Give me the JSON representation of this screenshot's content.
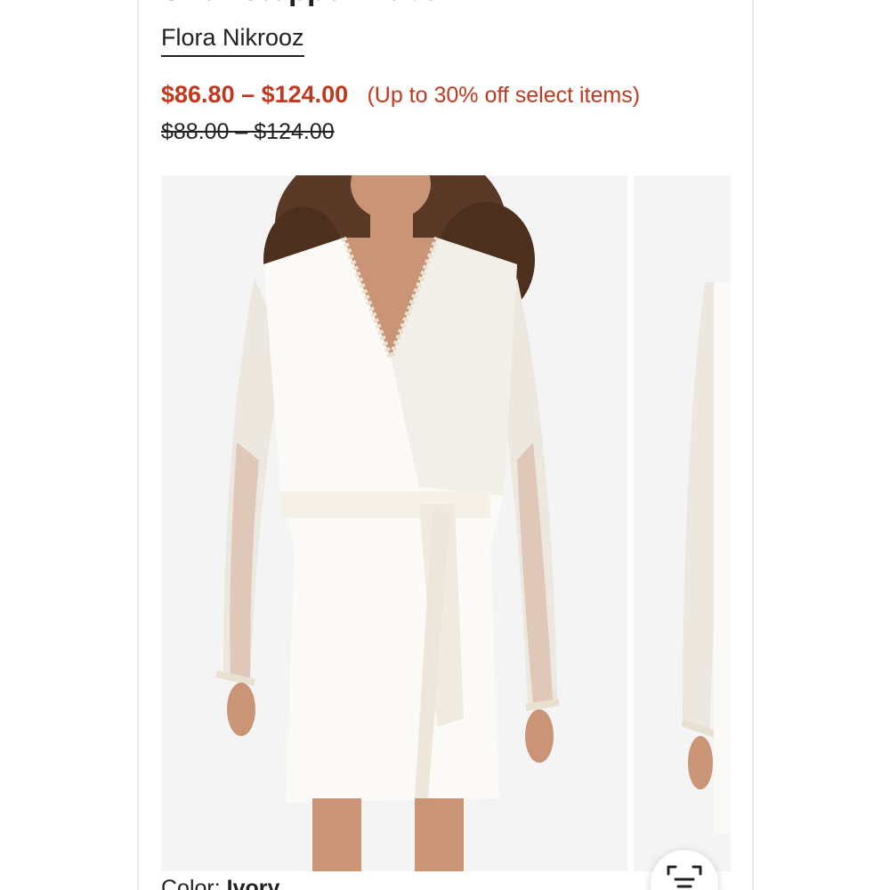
{
  "product": {
    "title": "Showstopper Robe",
    "brand": "Flora Nikrooz",
    "sale_price": "$86.80 – $124.00",
    "discount_note": "(Up to 30% off select items)",
    "original_price": "$88.00 – $124.00",
    "color_label": "Color: ",
    "color_value": "Ivory"
  },
  "colors": {
    "sale": "#c0391f",
    "text": "#222222",
    "background": "#ffffff"
  },
  "icons": {
    "scan_button": "scan-search-icon"
  }
}
